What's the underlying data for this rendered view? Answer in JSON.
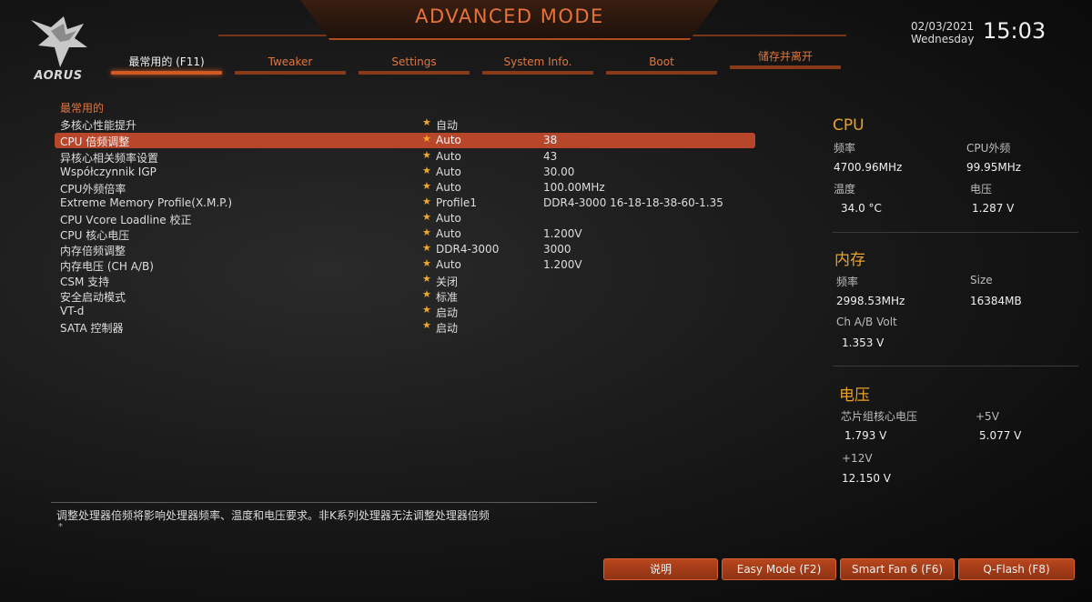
{
  "header": {
    "mode_title": "ADVANCED MODE",
    "logo_text": "AORUS",
    "date": "02/03/2021",
    "weekday": "Wednesday",
    "time": "15:03"
  },
  "tabs": [
    {
      "label": "最常用的 (F11)",
      "active": true
    },
    {
      "label": "Tweaker",
      "active": false
    },
    {
      "label": "Settings",
      "active": false
    },
    {
      "label": "System Info.",
      "active": false
    },
    {
      "label": "Boot",
      "active": false
    },
    {
      "label": "储存并离开",
      "active": false
    }
  ],
  "main": {
    "section_title": "最常用的",
    "rows": [
      {
        "label": "多核心性能提升",
        "option": "自动",
        "value": ""
      },
      {
        "label": "CPU 倍频调整",
        "option": "Auto",
        "value": "38",
        "selected": true
      },
      {
        "label": "异核心相关频率设置",
        "option": "Auto",
        "value": "43"
      },
      {
        "label": "Współczynnik IGP",
        "option": "Auto",
        "value": "30.00"
      },
      {
        "label": "CPU外频倍率",
        "option": "Auto",
        "value": "100.00MHz"
      },
      {
        "label": "Extreme Memory Profile(X.M.P.)",
        "option": "Profile1",
        "value": "DDR4-3000 16-18-18-38-60-1.35"
      },
      {
        "label": "CPU Vcore Loadline 校正",
        "option": "Auto",
        "value": ""
      },
      {
        "label": "CPU 核心电压",
        "option": "Auto",
        "value": "1.200V"
      },
      {
        "label": "内存倍频调整",
        "option": "DDR4-3000",
        "value": "3000"
      },
      {
        "label": "内存电压 (CH A/B)",
        "option": "Auto",
        "value": "1.200V"
      },
      {
        "label": "CSM 支持",
        "option": "关闭",
        "value": ""
      },
      {
        "label": "安全启动模式",
        "option": "标准",
        "value": ""
      },
      {
        "label": "VT-d",
        "option": "启动",
        "value": ""
      },
      {
        "label": "SATA 控制器",
        "option": "启动",
        "value": ""
      }
    ]
  },
  "panel": {
    "cpu": {
      "title": "CPU",
      "freq_label": "频率",
      "freq_value": "4700.96MHz",
      "bclk_label": "CPU外频",
      "bclk_value": "99.95MHz",
      "temp_label": "温度",
      "temp_value": "34.0 °C",
      "volt_label": "电压",
      "volt_value": "1.287 V"
    },
    "memory": {
      "title": "内存",
      "freq_label": "频率",
      "freq_value": "2998.53MHz",
      "size_label": "Size",
      "size_value": "16384MB",
      "volt_label": "Ch A/B Volt",
      "volt_value": "1.353 V"
    },
    "voltage": {
      "title": "电压",
      "chipset_label": "芯片组核心电压",
      "chipset_value": "1.793 V",
      "p5v_label": "+5V",
      "p5v_value": "5.077 V",
      "p12v_label": "+12V",
      "p12v_value": "12.150 V"
    }
  },
  "footer": {
    "description": "调整处理器倍频将影响处理器频率、温度和电压要求。非K系列处理器无法调整处理器倍频",
    "description_mark": "*",
    "buttons": [
      "说明",
      "Easy Mode (F2)",
      "Smart Fan 6 (F6)",
      "Q-Flash (F8)"
    ]
  },
  "colors": {
    "accent": "#cf5a25",
    "tab_text": "#e0763e",
    "panel_title": "#e8a228",
    "star": "#f2a928"
  }
}
